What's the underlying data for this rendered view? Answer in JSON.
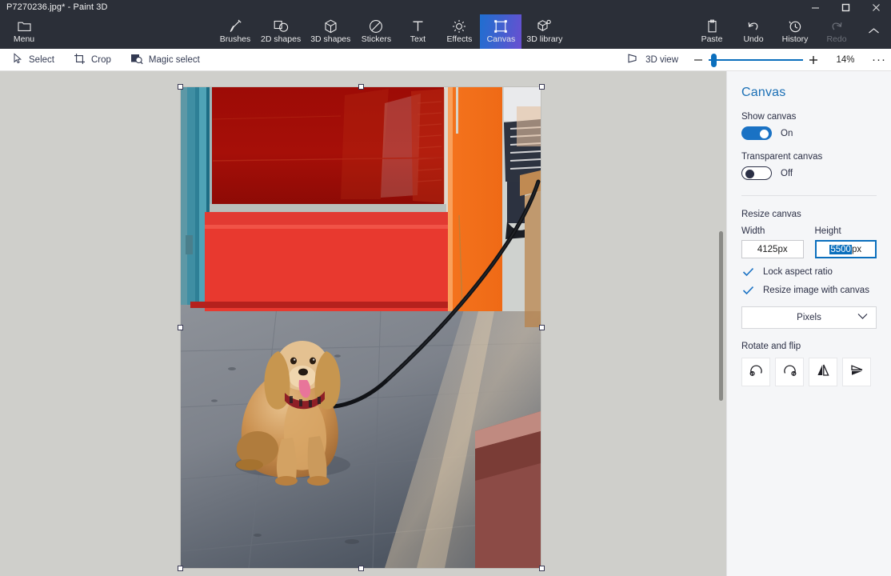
{
  "window": {
    "title": "P7270236.jpg* - Paint 3D",
    "controls": {
      "minimize": "–",
      "maximize": "□",
      "close": "✕"
    }
  },
  "ribbon": {
    "menu": {
      "label": "Menu",
      "icon": "folder-icon"
    },
    "tools": [
      {
        "label": "Brushes",
        "icon": "brush-icon",
        "active": false,
        "disabled": false
      },
      {
        "label": "2D shapes",
        "icon": "2d-shapes-icon",
        "active": false,
        "disabled": false
      },
      {
        "label": "3D shapes",
        "icon": "3d-shapes-icon",
        "active": false,
        "disabled": false
      },
      {
        "label": "Stickers",
        "icon": "stickers-icon",
        "active": false,
        "disabled": false
      },
      {
        "label": "Text",
        "icon": "text-icon",
        "active": false,
        "disabled": false
      },
      {
        "label": "Effects",
        "icon": "effects-icon",
        "active": false,
        "disabled": false
      },
      {
        "label": "Canvas",
        "icon": "canvas-icon",
        "active": true,
        "disabled": false
      },
      {
        "label": "3D library",
        "icon": "3d-library-icon",
        "active": false,
        "disabled": false
      }
    ],
    "actions": [
      {
        "label": "Paste",
        "icon": "clipboard-icon",
        "disabled": false
      },
      {
        "label": "Undo",
        "icon": "undo-icon",
        "disabled": false
      },
      {
        "label": "History",
        "icon": "history-icon",
        "disabled": false
      },
      {
        "label": "Redo",
        "icon": "redo-icon",
        "disabled": true
      }
    ],
    "collapse_icon": "chevron-up-icon",
    "active_accent_from": "#1f6fd0",
    "active_accent_to": "#6a4fd1"
  },
  "subtoolbar": {
    "tools": [
      {
        "label": "Select",
        "icon": "cursor-icon"
      },
      {
        "label": "Crop",
        "icon": "crop-icon"
      },
      {
        "label": "Magic select",
        "icon": "magic-select-icon"
      }
    ],
    "view3d": {
      "label": "3D view",
      "icon": "3d-view-icon"
    },
    "zoom": {
      "out_label": "–",
      "in_label": "+",
      "percent": "14%",
      "slider_value": 14,
      "slider_min": 0,
      "slider_max": 100,
      "accent": "#0b6fbd"
    },
    "more_label": "···"
  },
  "panel": {
    "heading": "Canvas",
    "show_canvas": {
      "label": "Show canvas",
      "state_text": "On",
      "on": true
    },
    "transparent_canvas": {
      "label": "Transparent canvas",
      "state_text": "Off",
      "on": false
    },
    "resize_section": "Resize canvas",
    "width": {
      "caption": "Width",
      "value": "4125",
      "unit": "px",
      "focused": false
    },
    "height": {
      "caption": "Height",
      "value": "5500",
      "unit": "px",
      "focused": true,
      "selected": true
    },
    "lock_aspect": {
      "label": "Lock aspect ratio",
      "checked": true,
      "icon": "check-icon"
    },
    "resize_image": {
      "label": "Resize image with canvas",
      "checked": true,
      "icon": "check-icon"
    },
    "units": {
      "value": "Pixels",
      "chevron": "chevron-down-icon"
    },
    "rotate_section": "Rotate and flip",
    "rotate_buttons": [
      {
        "name": "rotate-left",
        "icon": "rotate-counterclockwise-icon"
      },
      {
        "name": "rotate-right",
        "icon": "rotate-clockwise-icon"
      },
      {
        "name": "flip-horizontal",
        "icon": "flip-horizontal-icon"
      },
      {
        "name": "flip-vertical",
        "icon": "flip-vertical-icon"
      }
    ],
    "accent_blue": "#1a72c4",
    "heading_color": "#1a6fb5"
  },
  "canvas": {
    "image_description": "Golden cocker spaniel sitting on grey pavement in front of a red and orange shopfront",
    "selection_handles": 8,
    "background_color": "#cfcfcb"
  }
}
